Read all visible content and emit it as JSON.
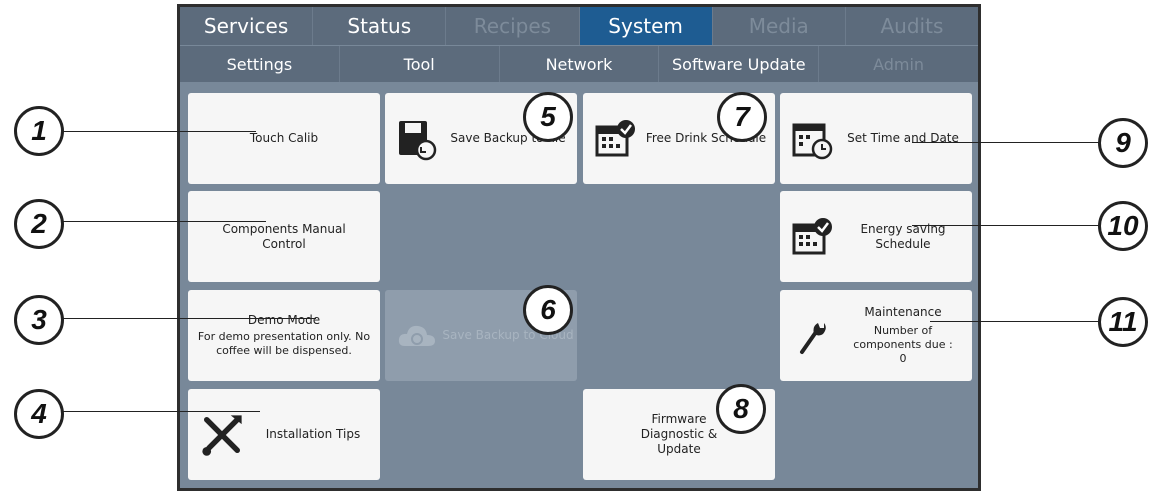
{
  "main_tabs": [
    "Services",
    "Status",
    "Recipes",
    "System",
    "Media",
    "Audits"
  ],
  "sub_tabs": [
    "Settings",
    "Tool",
    "Network",
    "Software Update",
    "Admin"
  ],
  "tiles": {
    "touch_calib": "Touch Calib",
    "save_backup_file": "Save Backup to file",
    "free_drink": "Free Drink Schedule",
    "set_time": "Set Time and Date",
    "components_manual": "Components Manual Control",
    "energy_saving": "Energy saving Schedule",
    "demo_mode_title": "Demo Mode",
    "demo_mode_desc": "For demo presentation only. No coffee will be dispensed.",
    "save_backup_cloud": "Save Backup to Cloud",
    "maintenance_title": "Maintenance",
    "maintenance_desc": "Number of components due : 0",
    "installation_tips": "Installation Tips",
    "firmware": "Firmware Diagnostic & Update"
  },
  "callouts": [
    "1",
    "2",
    "3",
    "4",
    "5",
    "6",
    "7",
    "8",
    "9",
    "10",
    "11"
  ],
  "icons": {
    "save_file": "floppy-restore-icon",
    "free_drink": "calendar-check-icon",
    "set_time": "calendar-clock-icon",
    "energy": "calendar-check-icon",
    "cloud": "cloud-icon",
    "maintenance": "wrench-icon",
    "installation": "tools-icon"
  },
  "colors": {
    "background": "#788899",
    "tab": "#5c6b7c",
    "active_tab": "#1e5c92",
    "tile": "#f6f6f6"
  }
}
